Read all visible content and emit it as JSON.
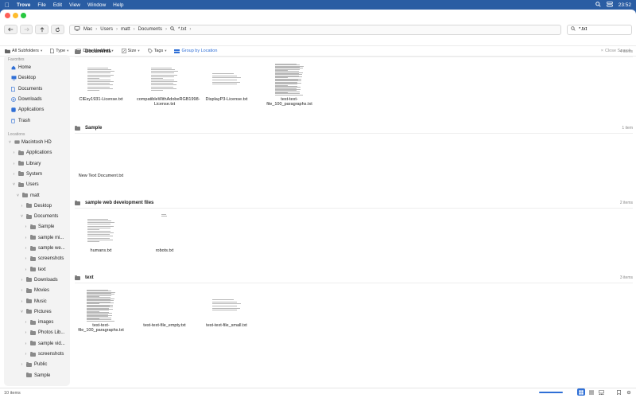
{
  "menubar": {
    "app_name": "Trove",
    "menus": [
      "File",
      "Edit",
      "View",
      "Window",
      "Help"
    ],
    "time": "23:52"
  },
  "toolbar": {
    "back_icon": "arrow-left-icon",
    "forward_icon": "arrow-right-icon",
    "up_icon": "arrow-up-icon",
    "refresh_icon": "refresh-icon",
    "path": [
      "Mac",
      "Users",
      "matt",
      "Documents"
    ],
    "search_scope": "*.txt",
    "search_value": "*.txt"
  },
  "filters": {
    "subfolders": "All Subfolders",
    "type": "Type",
    "date_modified": "Date Modified",
    "size": "Size",
    "tags": "Tags",
    "group_by": "Group by Location",
    "close_search": "Close Search"
  },
  "sidebar": {
    "favorites_heading": "Favorites",
    "favorites": [
      {
        "label": "Home",
        "icon": "home-icon",
        "color": "#2f6fd6"
      },
      {
        "label": "Desktop",
        "icon": "desktop-icon",
        "color": "#2f6fd6"
      },
      {
        "label": "Documents",
        "icon": "document-icon",
        "color": "#2f6fd6"
      },
      {
        "label": "Downloads",
        "icon": "download-icon",
        "color": "#2f6fd6"
      },
      {
        "label": "Applications",
        "icon": "applications-icon",
        "color": "#2f6fd6"
      },
      {
        "label": "Trash",
        "icon": "trash-icon",
        "color": "#2f6fd6"
      }
    ],
    "locations_heading": "Locations",
    "tree": [
      {
        "label": "Macintosh HD",
        "depth": 0,
        "expanded": true,
        "icon": "drive-icon"
      },
      {
        "label": "Applications",
        "depth": 1,
        "expanded": false,
        "icon": "folder-icon"
      },
      {
        "label": "Library",
        "depth": 1,
        "expanded": false,
        "icon": "folder-icon"
      },
      {
        "label": "System",
        "depth": 1,
        "expanded": false,
        "icon": "folder-icon"
      },
      {
        "label": "Users",
        "depth": 1,
        "expanded": true,
        "icon": "folder-icon"
      },
      {
        "label": "matt",
        "depth": 2,
        "expanded": true,
        "icon": "folder-icon"
      },
      {
        "label": "Desktop",
        "depth": 3,
        "expanded": false,
        "icon": "folder-icon"
      },
      {
        "label": "Documents",
        "depth": 3,
        "expanded": true,
        "icon": "folder-icon"
      },
      {
        "label": "Sample",
        "depth": 4,
        "expanded": false,
        "icon": "folder-icon"
      },
      {
        "label": "sample mi...",
        "depth": 4,
        "expanded": false,
        "icon": "folder-icon"
      },
      {
        "label": "sample we...",
        "depth": 4,
        "expanded": false,
        "icon": "folder-icon"
      },
      {
        "label": "screenshots",
        "depth": 4,
        "expanded": false,
        "icon": "folder-icon"
      },
      {
        "label": "text",
        "depth": 4,
        "expanded": false,
        "icon": "folder-icon"
      },
      {
        "label": "Downloads",
        "depth": 3,
        "expanded": false,
        "icon": "folder-icon"
      },
      {
        "label": "Movies",
        "depth": 3,
        "expanded": false,
        "icon": "folder-icon"
      },
      {
        "label": "Music",
        "depth": 3,
        "expanded": false,
        "icon": "folder-icon"
      },
      {
        "label": "Pictures",
        "depth": 3,
        "expanded": true,
        "icon": "folder-icon"
      },
      {
        "label": "images",
        "depth": 4,
        "expanded": false,
        "icon": "folder-icon"
      },
      {
        "label": "Photos Lib...",
        "depth": 4,
        "expanded": false,
        "icon": "folder-icon"
      },
      {
        "label": "sample vid...",
        "depth": 4,
        "expanded": false,
        "icon": "folder-icon"
      },
      {
        "label": "screenshots",
        "depth": 4,
        "expanded": false,
        "icon": "folder-icon"
      },
      {
        "label": "Public",
        "depth": 3,
        "expanded": false,
        "icon": "folder-icon"
      },
      {
        "label": "Sample",
        "depth": 3,
        "expanded": null,
        "icon": "folder-icon"
      }
    ]
  },
  "sections": [
    {
      "title": "Documents",
      "count": "4 items",
      "files": [
        {
          "name": "CIExy1931-License.txt",
          "density": "medium"
        },
        {
          "name": "compatibleWithAdobeRGB1998-License.txt",
          "density": "medium"
        },
        {
          "name": "DisplayP3-License.txt",
          "density": "short"
        },
        {
          "name": "test-text-file_100_paragraphs.txt",
          "density": "dense"
        }
      ]
    },
    {
      "title": "Sample",
      "count": "1 item",
      "files": [
        {
          "name": "New Text Document.txt",
          "density": "empty"
        }
      ]
    },
    {
      "title": "sample web development files",
      "count": "2 items",
      "files": [
        {
          "name": "humans.txt",
          "density": "medium"
        },
        {
          "name": "robots.txt",
          "density": "tiny"
        }
      ]
    },
    {
      "title": "text",
      "count": "3 items",
      "files": [
        {
          "name": "test-text-file_100_paragraphs.txt",
          "density": "dense"
        },
        {
          "name": "test-text-file_empty.txt",
          "density": "empty"
        },
        {
          "name": "test-text-file_small.txt",
          "density": "short"
        }
      ]
    }
  ],
  "status": {
    "item_count": "10 items",
    "zoom_level_fraction": 0.5
  },
  "view_modes": [
    "grid-view-icon",
    "list-view-icon",
    "gallery-view-icon"
  ],
  "colors": {
    "accent": "#2f6fd6",
    "menubar": "#2a5da3",
    "sidebar_bg": "#f3f3f3"
  }
}
